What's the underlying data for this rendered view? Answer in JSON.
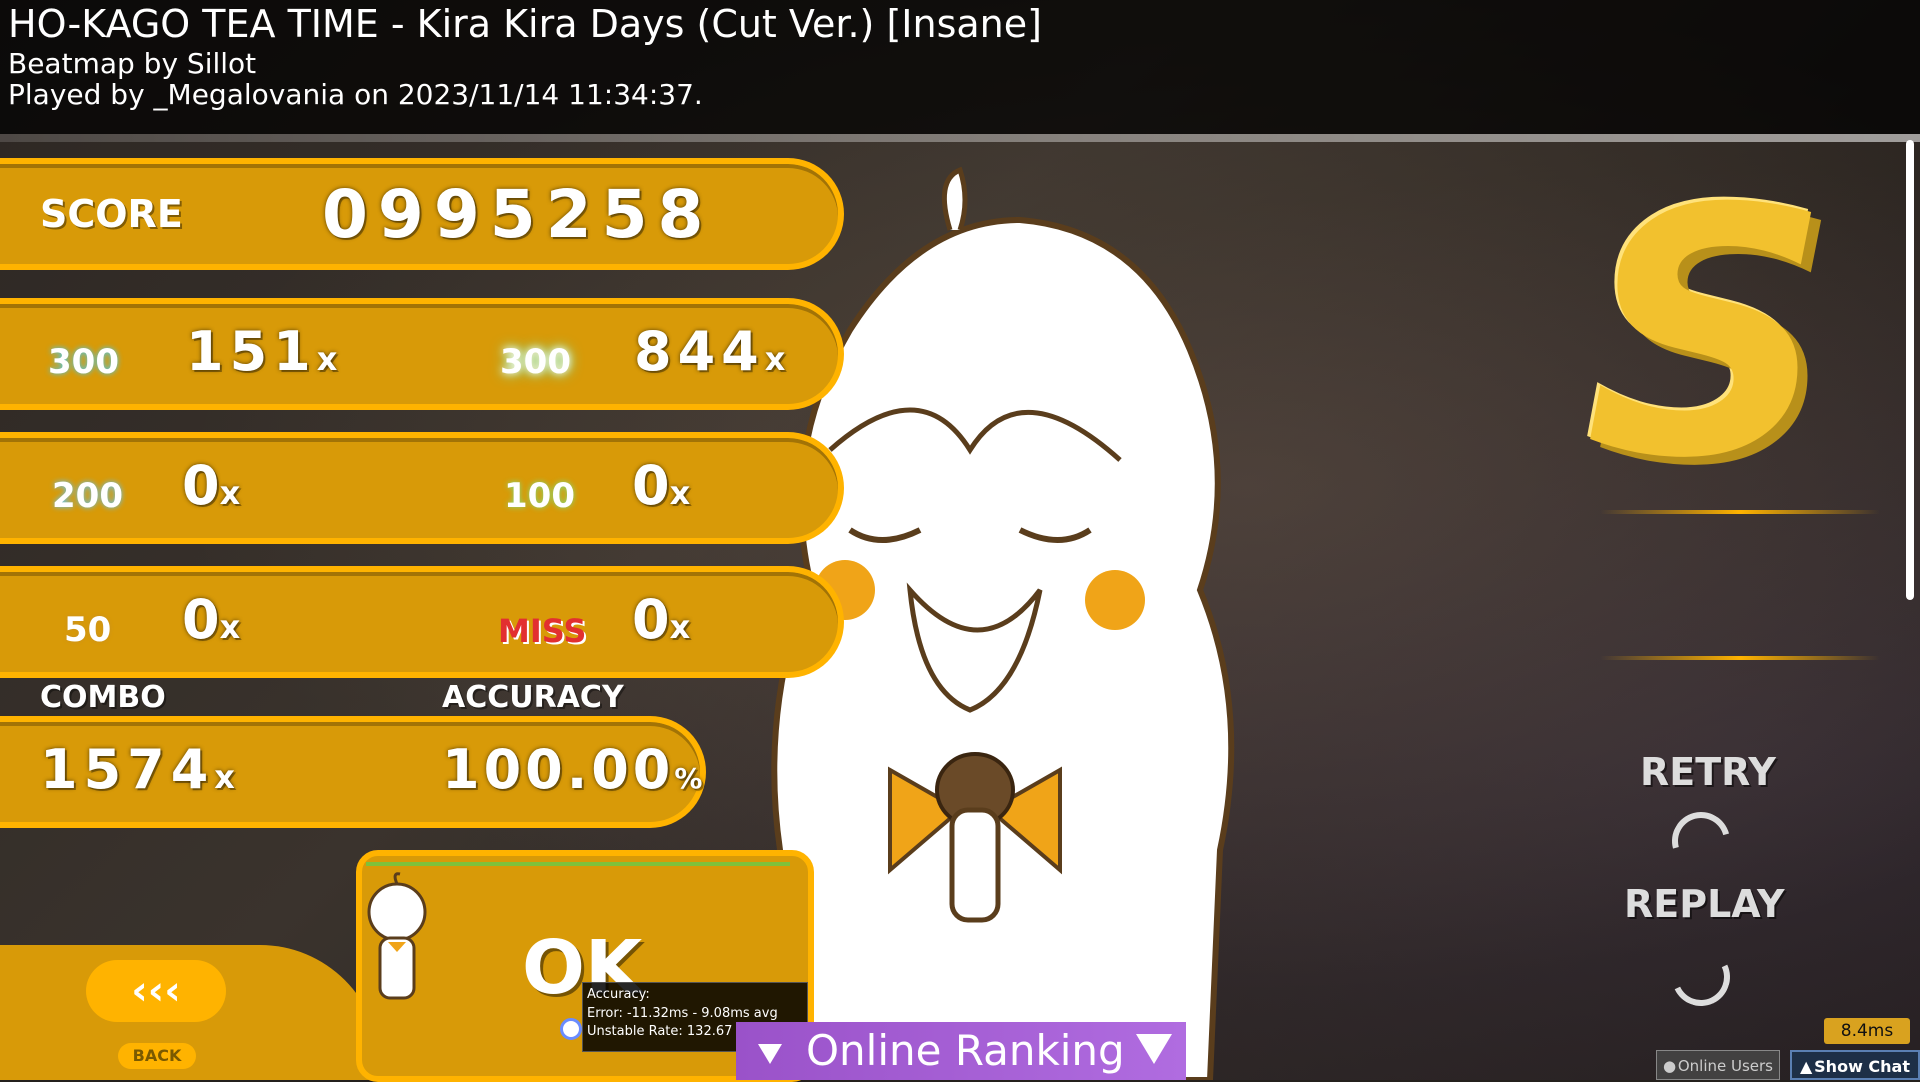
{
  "header": {
    "title": "HO-KAGO TEA TIME - Kira Kira Days (Cut Ver.) [Insane]",
    "beatmap_by": "Beatmap by Sillot",
    "played_by": "Played by _Megalovania on 2023/11/14 11:34:37."
  },
  "score": {
    "label": "SCORE",
    "value": "0995258"
  },
  "hits": {
    "h300": {
      "label": "300",
      "count": "151"
    },
    "geki": {
      "label": "300",
      "count": "844"
    },
    "h100": {
      "label": "200",
      "count": "0"
    },
    "katu": {
      "label": "100",
      "count": "0"
    },
    "h50": {
      "label": "50",
      "count": "0"
    },
    "miss": {
      "label": "MISS",
      "count": "0"
    },
    "x_suffix": "x"
  },
  "combo": {
    "label": "COMBO",
    "value": "1574",
    "suffix": "x"
  },
  "accuracy": {
    "label": "ACCURACY",
    "value": "100.00",
    "suffix": "%"
  },
  "rank": {
    "grade": "S"
  },
  "actions": {
    "retry": "RETRY",
    "replay": "REPLAY"
  },
  "back": {
    "arrows": "‹‹‹",
    "label": "BACK"
  },
  "performance": {
    "verdict": "OK",
    "progress": 1.0
  },
  "tooltip": {
    "line1": "Accuracy:",
    "line2": "Error: -11.32ms - 9.08ms avg",
    "line3": "Unstable Rate: 132.67"
  },
  "online_ranking": {
    "label": "Online Ranking"
  },
  "status": {
    "latency": "8.4ms",
    "online_users": "Online Users",
    "show_chat": "Show Chat"
  },
  "colors": {
    "panel": "#d89a08",
    "panel_border": "#ffb300",
    "rank": "#f2c12e",
    "ranking_bar": "#a95fd8"
  }
}
